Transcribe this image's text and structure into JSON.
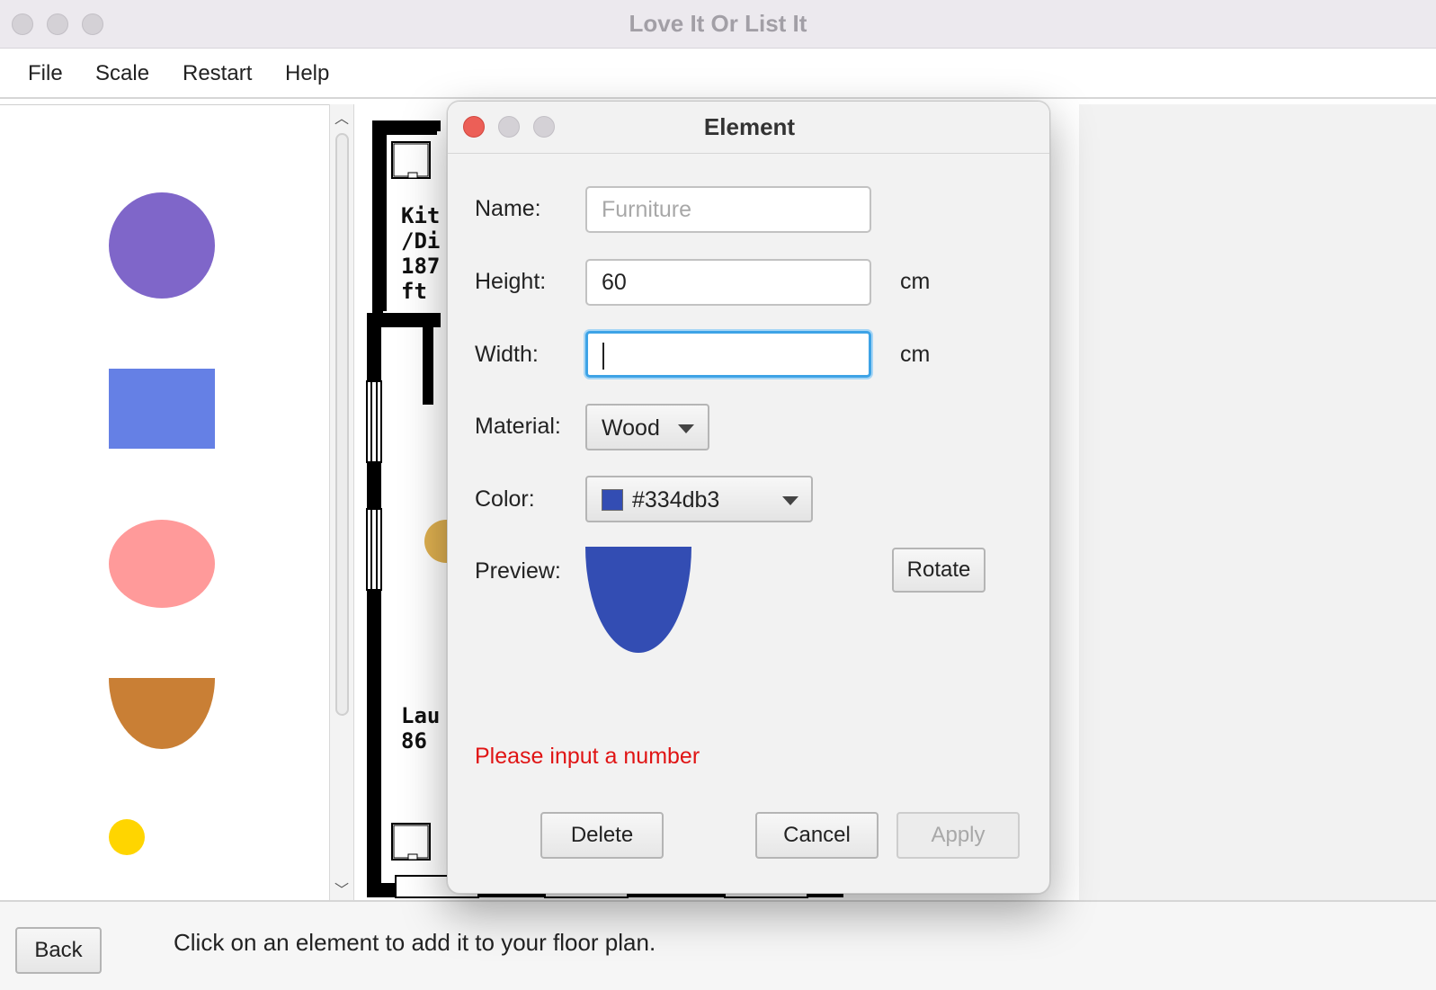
{
  "window": {
    "title": "Love It Or List It"
  },
  "menu": {
    "items": [
      "File",
      "Scale",
      "Restart",
      "Help"
    ]
  },
  "palette": {
    "shapes": [
      {
        "kind": "circle",
        "color": "#7f66c9"
      },
      {
        "kind": "rectangle",
        "color": "#6580e5"
      },
      {
        "kind": "ellipse",
        "color": "#ff9a9a"
      },
      {
        "kind": "half-ellipse",
        "color": "#c97f35"
      },
      {
        "kind": "small-circle",
        "color": "#ffd500"
      }
    ]
  },
  "floorplan": {
    "labels": {
      "room1_line1": "Kit",
      "room1_line2": "/Di",
      "room1_line3": "187",
      "room1_line4": "ft",
      "room2_line1": "Lau",
      "room2_line2": "86"
    }
  },
  "dialog": {
    "title": "Element",
    "name_label": "Name:",
    "name_placeholder": "Furniture",
    "name_value": "",
    "height_label": "Height:",
    "height_value": "60",
    "height_unit": "cm",
    "width_label": "Width:",
    "width_value": "",
    "width_unit": "cm",
    "material_label": "Material:",
    "material_value": "Wood",
    "color_label": "Color:",
    "color_value": "#334db3",
    "preview_label": "Preview:",
    "preview_color": "#334db3",
    "rotate_label": "Rotate",
    "error_message": "Please input a number",
    "delete_label": "Delete",
    "cancel_label": "Cancel",
    "apply_label": "Apply"
  },
  "bottom": {
    "back_label": "Back",
    "status": "Click on an element to add it to your floor plan."
  },
  "colors": {
    "focus_ring": "#3ea3e6",
    "error": "#e01414",
    "close_red": "#ec5f57"
  }
}
